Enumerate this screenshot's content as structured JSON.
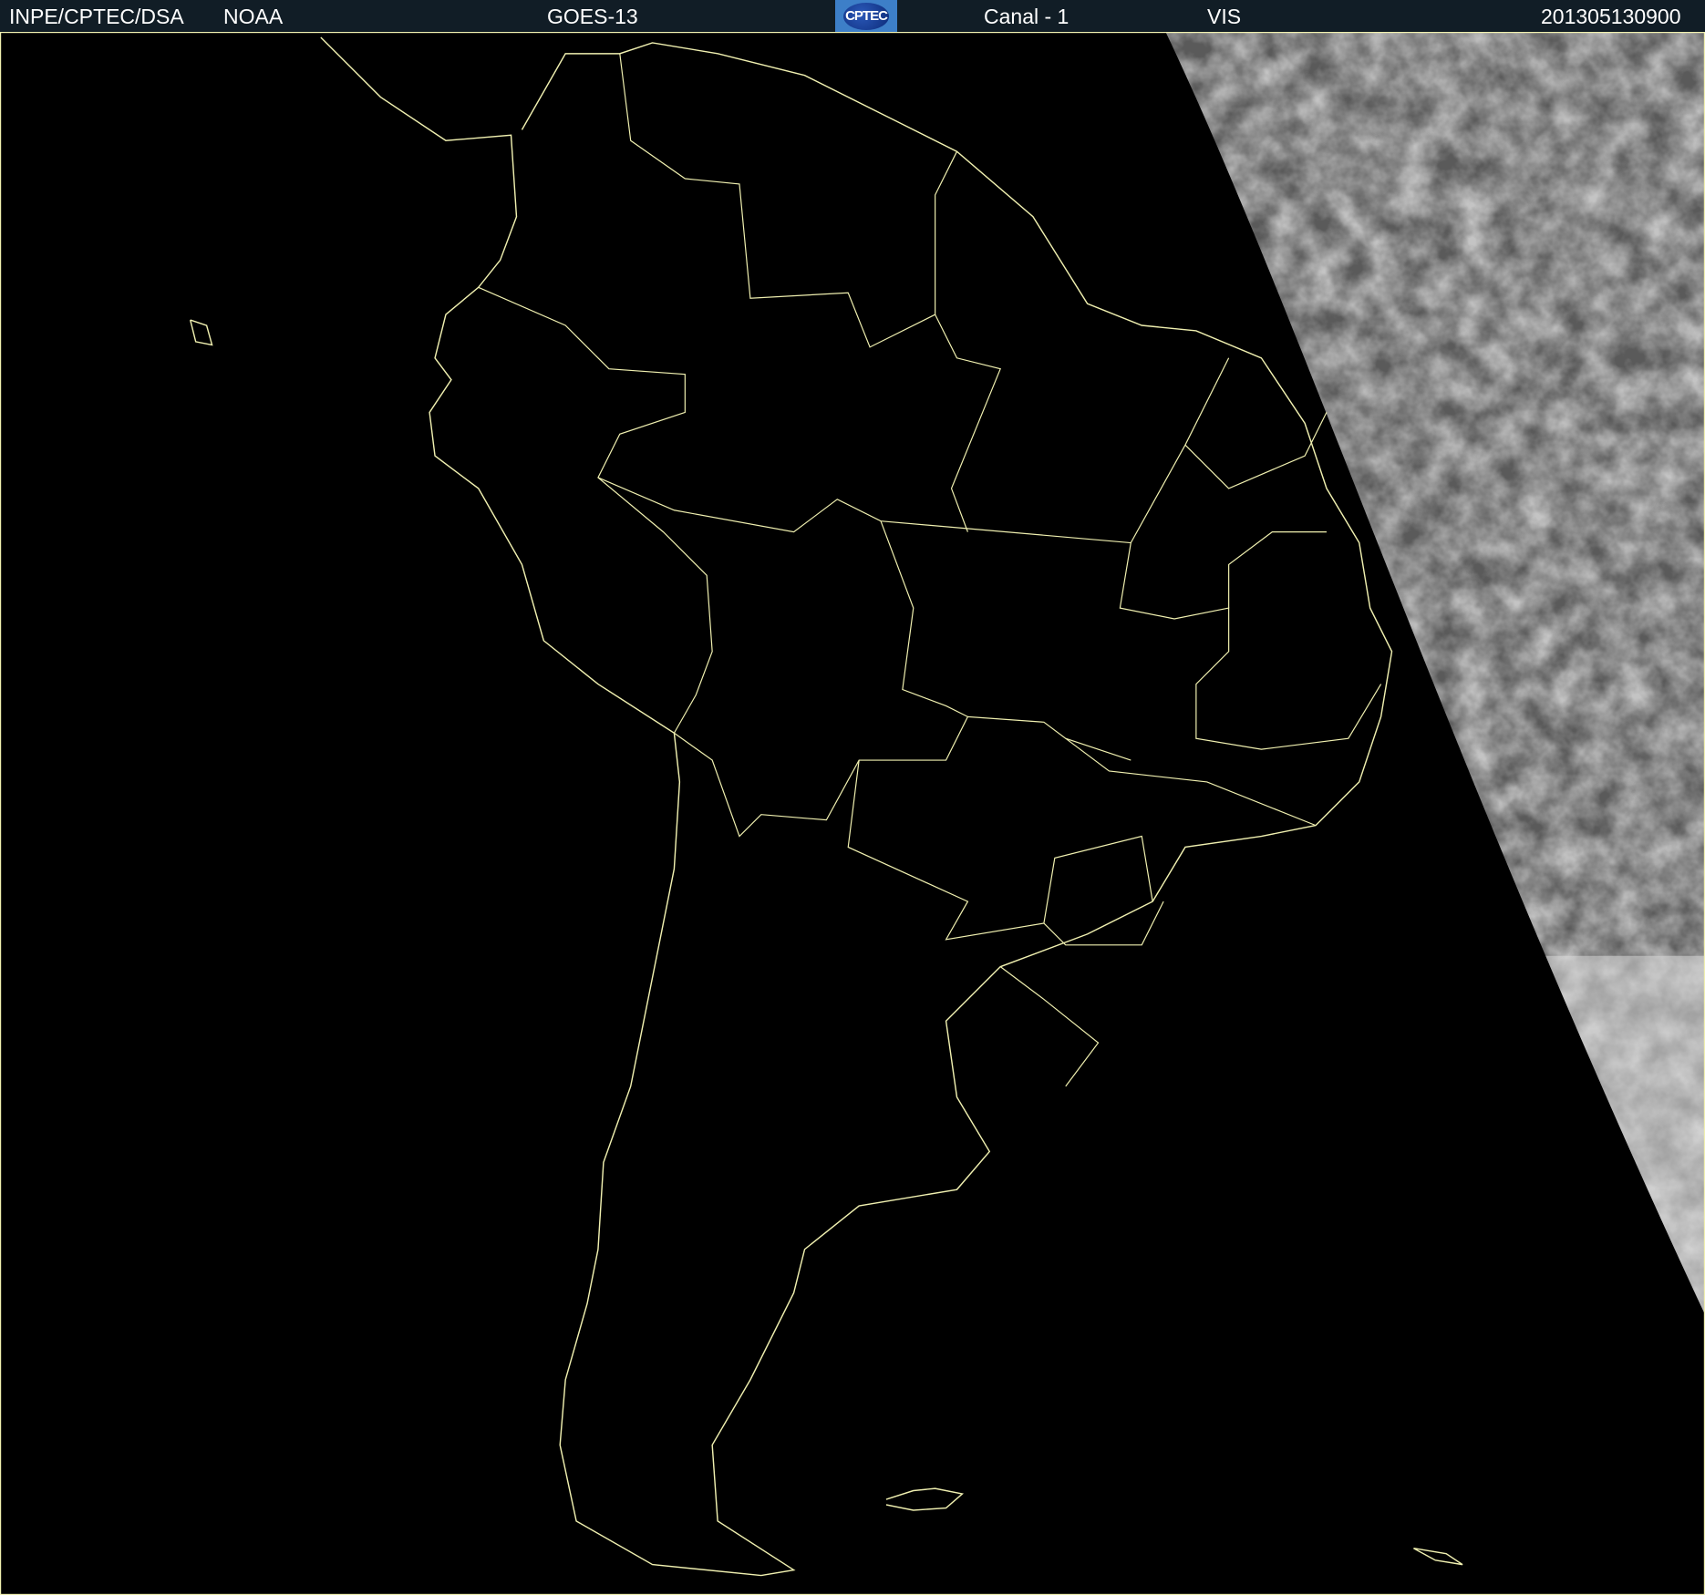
{
  "header": {
    "agency": "INPE/CPTEC/DSA",
    "source": "NOAA",
    "satellite": "GOES-13",
    "logo_text": "CPTEC",
    "channel": "Canal - 1",
    "band": "VIS",
    "timestamp": "201305130900"
  },
  "colors": {
    "header_bg": "#111d26",
    "border_lines": "#f0f0b0",
    "logo_bg": "#3d7fc8"
  }
}
